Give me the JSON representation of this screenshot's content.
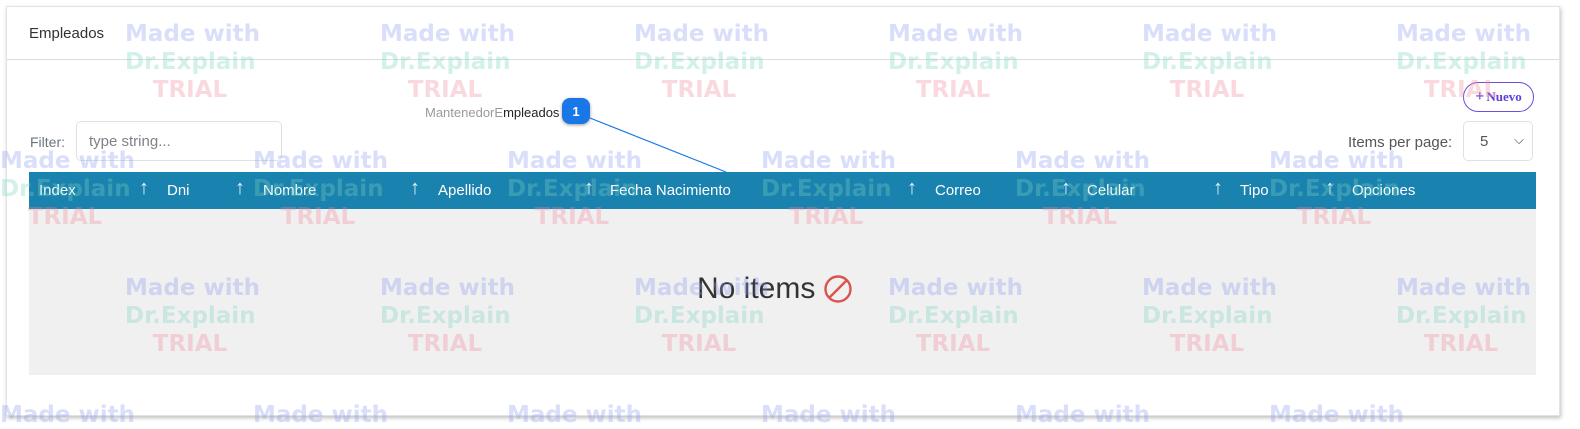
{
  "card": {
    "title": "Empleados"
  },
  "toolbar": {
    "nuevo_label": "Nuevo",
    "nuevo_icon": "plus-icon"
  },
  "filter": {
    "label": "Filter:",
    "placeholder": "type string..."
  },
  "pagination": {
    "items_per_page_label": "Items per page:",
    "items_per_page_value": "5"
  },
  "table": {
    "columns": [
      "Index",
      "Dni",
      "Nombre",
      "Apellido",
      "Fecha Nacimiento",
      "Correo",
      "Celular",
      "Tipo",
      "Opciones"
    ],
    "empty_text": "No items",
    "empty_icon": "no-entry-icon"
  },
  "callout": {
    "text_dim": "MantenedorE",
    "text": "mpleados",
    "badge": "1"
  },
  "watermark": {
    "line1": "Made with",
    "line2": "Dr.Explain",
    "line3": "TRIAL"
  },
  "colors": {
    "header_bg": "#1a82ae",
    "accent_purple": "#5a3fd8",
    "badge_blue": "#1a77e8",
    "empty_icon_red": "#d9534f"
  }
}
